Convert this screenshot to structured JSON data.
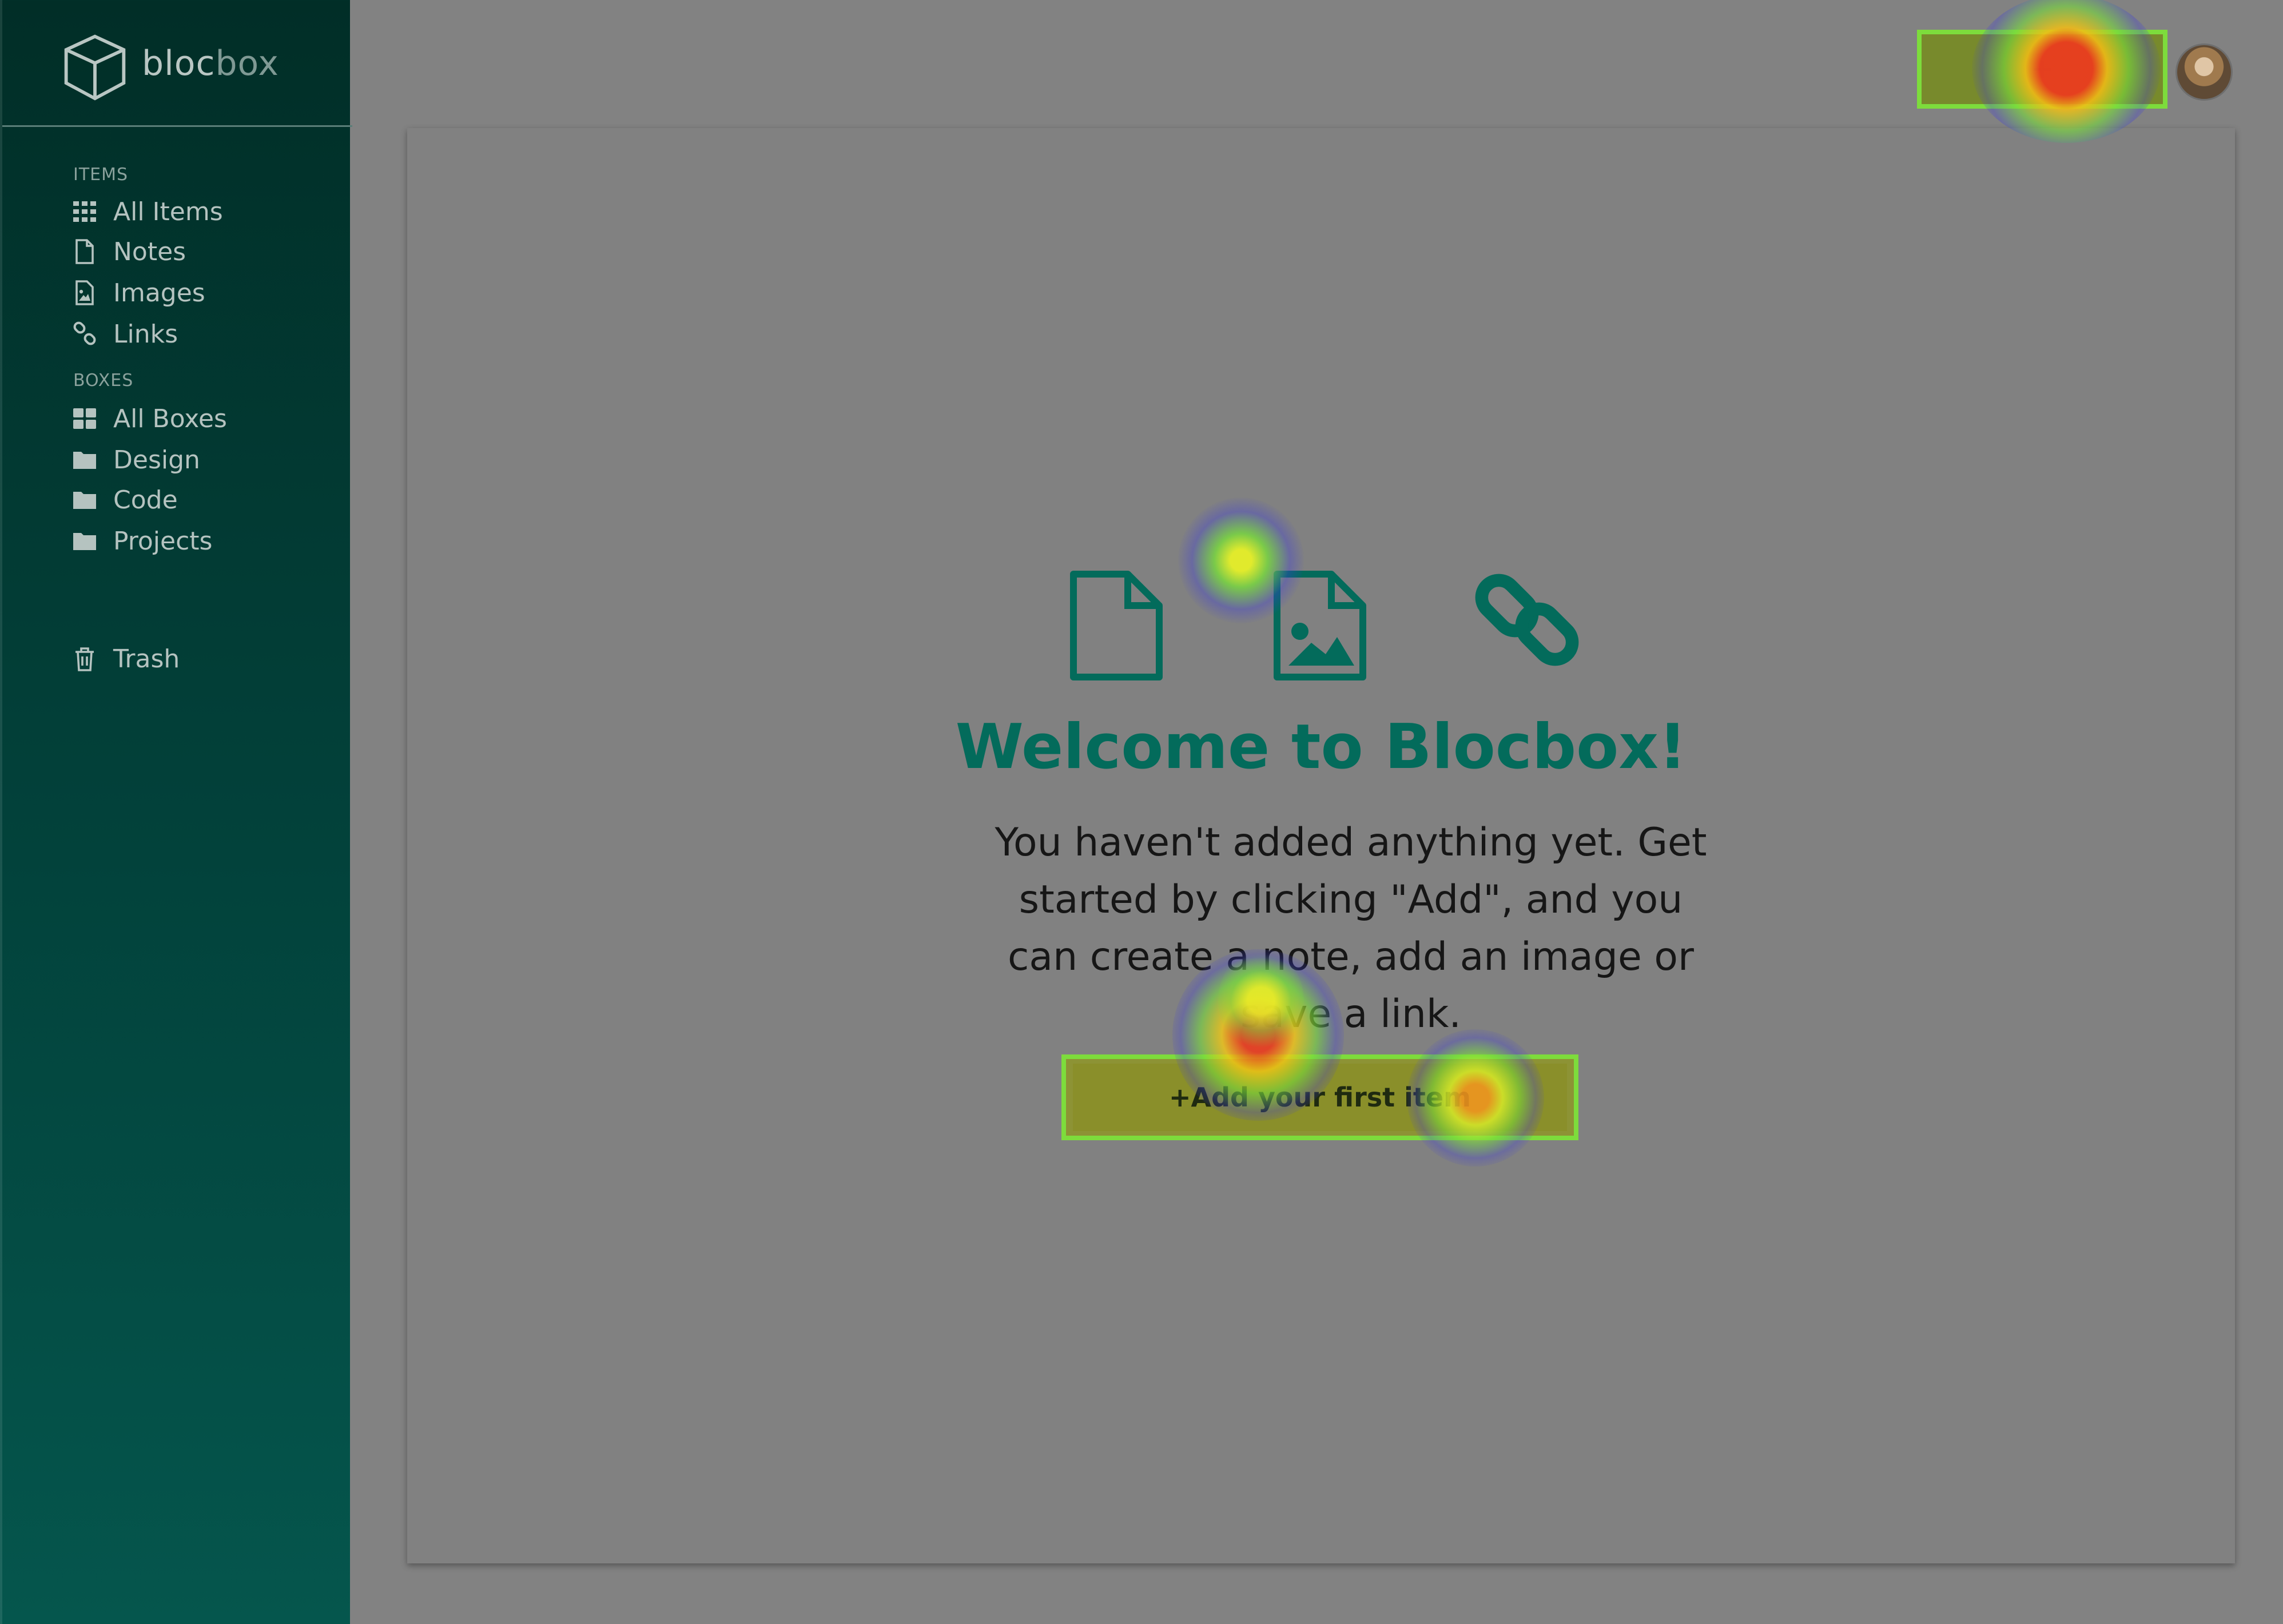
{
  "brand": {
    "name_main": "bloc",
    "name_suffix": "box"
  },
  "sidebar": {
    "items_header": "ITEMS",
    "items": [
      {
        "label": "All Items",
        "icon": "grid-icon"
      },
      {
        "label": "Notes",
        "icon": "file-icon"
      },
      {
        "label": "Images",
        "icon": "image-file-icon"
      },
      {
        "label": "Links",
        "icon": "link-icon"
      }
    ],
    "boxes_header": "BOXES",
    "boxes": [
      {
        "label": "All Boxes",
        "icon": "squares-icon"
      },
      {
        "label": "Design",
        "icon": "folder-icon"
      },
      {
        "label": "Code",
        "icon": "folder-icon"
      },
      {
        "label": "Projects",
        "icon": "folder-icon"
      }
    ],
    "trash": {
      "label": "Trash",
      "icon": "trash-icon"
    }
  },
  "topbar": {
    "add_label": "+"
  },
  "main": {
    "title": "Welcome to Blocbox!",
    "body": "You haven't added anything yet. Get started by clicking \"Add\", and you can create a note, add an image or save a link.",
    "cta_label": "+Add your first item"
  },
  "colors": {
    "accent": "#036b5b",
    "sidebar_top": "#012e27",
    "sidebar_bottom": "#05564d",
    "highlight_box": "#7ddc3c"
  }
}
